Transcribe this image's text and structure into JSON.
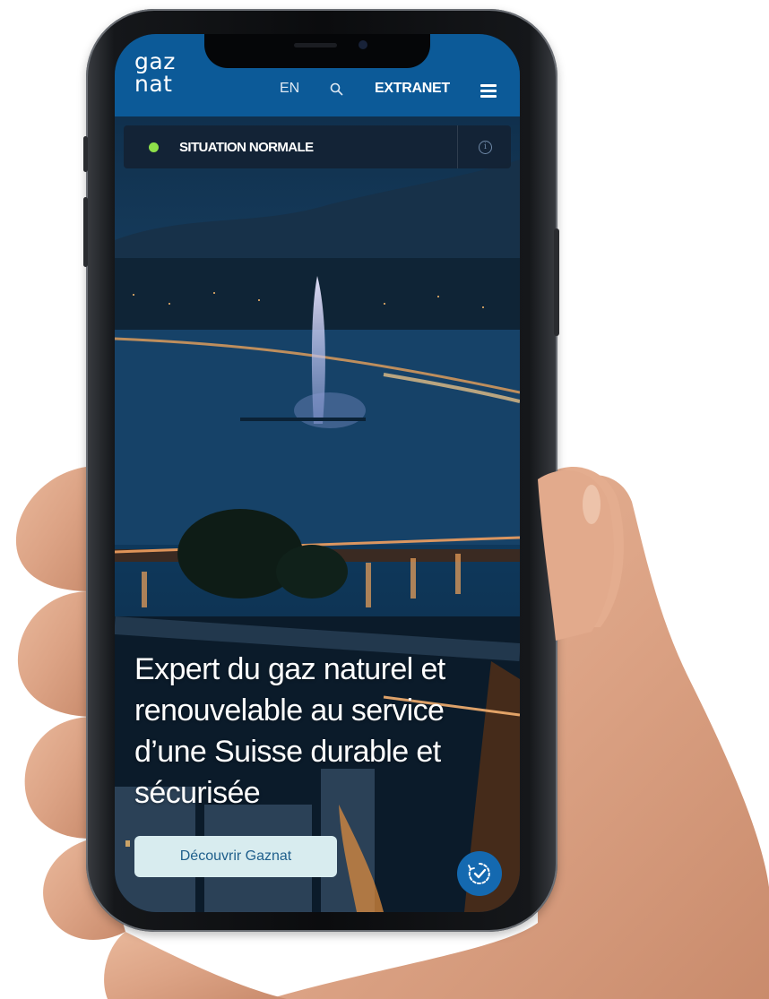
{
  "header": {
    "logo_line1": "gaz",
    "logo_line2": "nat",
    "language": "EN",
    "extranet": "EXTRANET",
    "search_icon": "search-icon",
    "menu_icon": "hamburger-menu-icon"
  },
  "status": {
    "label": "SITUATION NORMALE",
    "indicator_color": "#8ee04a",
    "info_icon": "info-icon"
  },
  "hero": {
    "title": "Expert du gaz naturel et renouvelable au service d’une Suisse durable et sécurisée",
    "cta": "Découvrir Gaznat"
  },
  "fab": {
    "icon": "accessibility-check-icon"
  },
  "colors": {
    "header_bg": "#0c5a98",
    "cta_bg": "#d8ecef",
    "cta_text": "#1f5f8c",
    "fab_bg": "#1469b0"
  }
}
